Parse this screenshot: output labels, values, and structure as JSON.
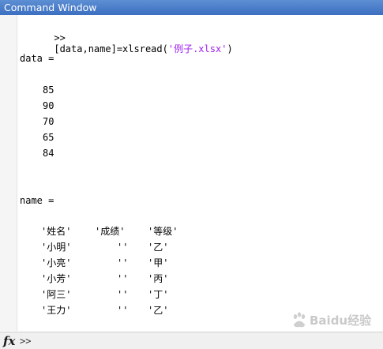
{
  "window": {
    "title": "Command Window"
  },
  "command": {
    "prompt": ">>",
    "code": "[data,name]=xlsread(",
    "string_arg": "'例子.xlsx'",
    "close": ")"
  },
  "output": {
    "data_label": "data =",
    "data_values": [
      "85",
      "90",
      "70",
      "65",
      "84"
    ],
    "name_label": "name =",
    "name_rows": [
      [
        "'姓名'",
        "'成绩'",
        "'等级'"
      ],
      [
        "'小明'",
        "''",
        "'乙'"
      ],
      [
        "'小亮'",
        "''",
        "'甲'"
      ],
      [
        "'小芳'",
        "''",
        "'丙'"
      ],
      [
        "'阿三'",
        "''",
        "'丁'"
      ],
      [
        "'王力'",
        "''",
        "'乙'"
      ]
    ]
  },
  "bottom": {
    "fx_label": "fx",
    "prompt": ">>"
  },
  "watermark": {
    "text": "Baidu经验",
    "icon": "baidu-paw-icon"
  },
  "colors": {
    "title_bar": "#3c6fc0",
    "string": "#a020f0"
  }
}
